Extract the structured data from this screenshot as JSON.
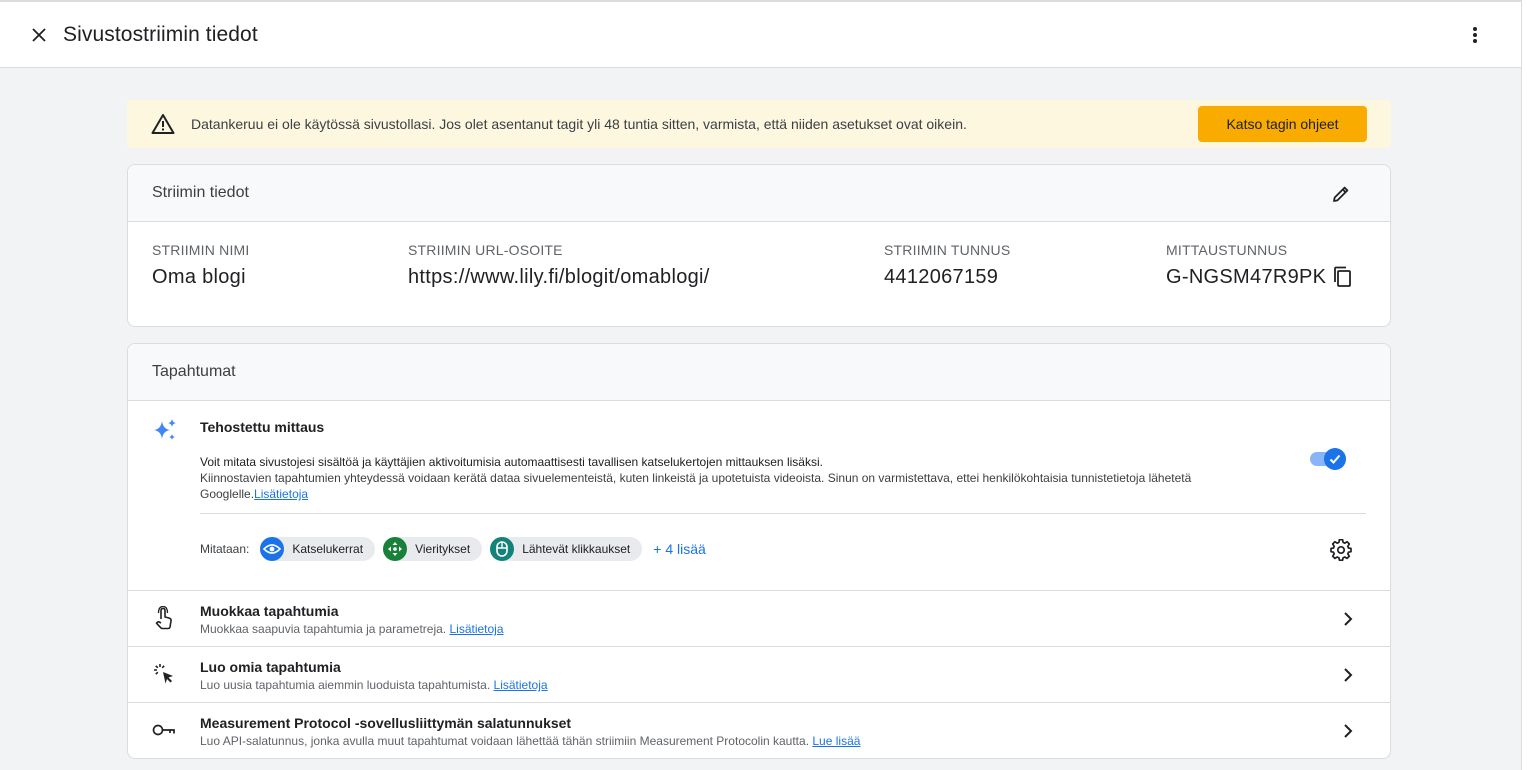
{
  "header": {
    "title": "Sivustostriimin tiedot"
  },
  "banner": {
    "text": "Datankeruu ei ole käytössä sivustollasi. Jos olet asentanut tagit yli 48 tuntia sitten, varmista, että niiden asetukset ovat oikein.",
    "button_label": "Katso tagin ohjeet"
  },
  "stream_details": {
    "title": "Striimin tiedot",
    "columns": [
      {
        "label": "STRIIMIN NIMI",
        "value": "Oma blogi"
      },
      {
        "label": "STRIIMIN URL-OSOITE",
        "value": "https://www.lily.fi/blogit/omablogi/"
      },
      {
        "label": "STRIIMIN TUNNUS",
        "value": "4412067159"
      },
      {
        "label": "MITTAUSTUNNUS",
        "value": "G-NGSM47R9PK"
      }
    ]
  },
  "events": {
    "title": "Tapahtumat",
    "enhanced": {
      "title": "Tehostettu mittaus",
      "desc1": "Voit mitata sivustojesi sisältöä ja käyttäjien aktivoitumisia automaattisesti tavallisen katselukertojen mittauksen lisäksi.",
      "desc2": "Kiinnostavien tapahtumien yhteydessä voidaan kerätä dataa sivuelementeistä, kuten linkeistä ja upotetuista videoista. Sinun on varmistettava, ettei henkilökohtaisia tunnistetietoja lähetetä Googlelle.",
      "link": "Lisätietoja",
      "toggle_on": true,
      "measured_label": "Mitataan:",
      "chips": [
        "Katselukerrat",
        "Vieritykset",
        "Lähtevät klikkaukset"
      ],
      "more_label": "+ 4 lisää"
    },
    "rows": [
      {
        "title": "Muokkaa tapahtumia",
        "desc": "Muokkaa saapuvia tapahtumia ja parametreja.",
        "link": "Lisätietoja",
        "icon": "touch-icon"
      },
      {
        "title": "Luo omia tapahtumia",
        "desc": "Luo uusia tapahtumia aiemmin luoduista tapahtumista.",
        "link": "Lisätietoja",
        "icon": "click-icon"
      },
      {
        "title": "Measurement Protocol -sovellusliittymän salatunnukset",
        "desc": "Luo API-salatunnus, jonka avulla muut tapahtumat voidaan lähettää tähän striimiin Measurement Protocolin kautta.",
        "link": "Lue lisää",
        "icon": "key-icon"
      }
    ]
  },
  "colors": {
    "accent": "#1a73e8",
    "banner_bg": "#fef7e0",
    "banner_button": "#f9ab00",
    "chip_blue": "#1a73e8",
    "chip_green": "#188038",
    "chip_teal": "#12827a"
  }
}
